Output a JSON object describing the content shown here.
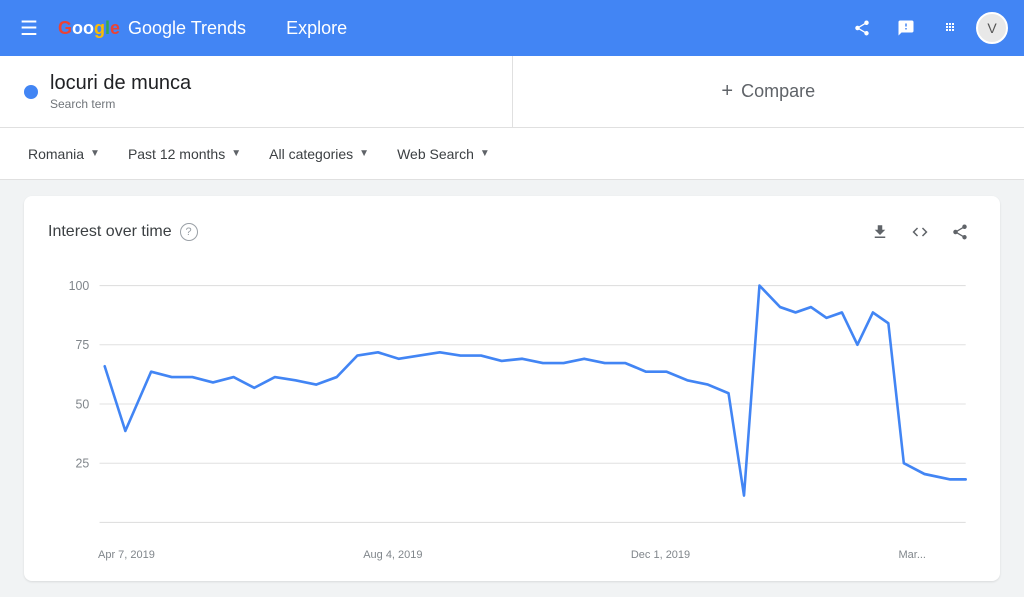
{
  "header": {
    "menu_icon": "☰",
    "logo_text": "Google Trends",
    "explore_label": "Explore",
    "share_icon": "share",
    "feedback_icon": "feedback",
    "apps_icon": "apps",
    "avatar_label": "V"
  },
  "search": {
    "term": "locuri de munca",
    "term_type": "Search term",
    "compare_label": "Compare",
    "compare_plus": "+"
  },
  "filters": {
    "region": "Romania",
    "time_period": "Past 12 months",
    "category": "All categories",
    "search_type": "Web Search"
  },
  "chart": {
    "title": "Interest over time",
    "help_label": "?",
    "download_icon": "⬇",
    "embed_icon": "<>",
    "share_icon": "share",
    "y_labels": [
      "100",
      "75",
      "50",
      "25"
    ],
    "x_labels": [
      "Apr 7, 2019",
      "Aug 4, 2019",
      "Dec 1, 2019",
      "Mar..."
    ]
  }
}
